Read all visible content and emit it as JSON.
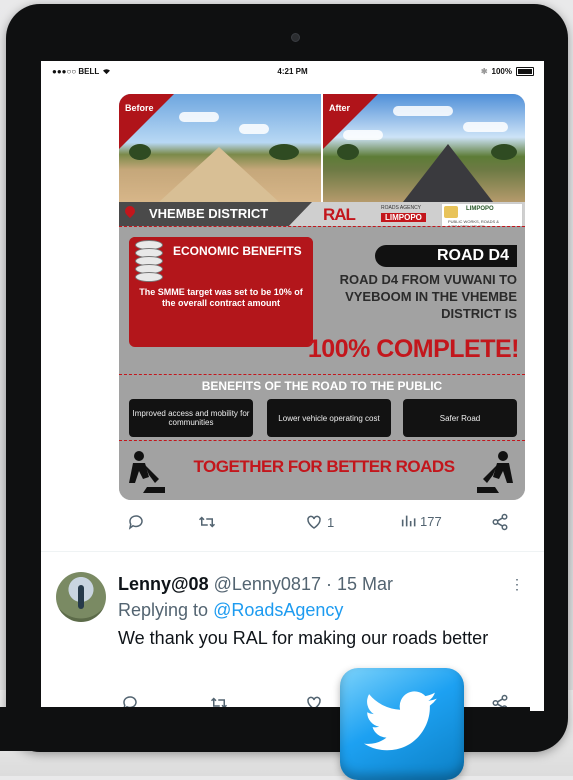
{
  "status_bar": {
    "carrier": "●●●○○ BELL",
    "time": "4:21 PM",
    "battery": "100%"
  },
  "poster": {
    "before_label": "Before",
    "after_label": "After",
    "district": "VHEMBE DISTRICT",
    "logo": {
      "brand": "RAL",
      "agency": "ROADS AGENCY",
      "region": "LIMPOPO"
    },
    "dept_logo": {
      "name": "LIMPOPO",
      "subtitle": "PUBLIC WORKS, ROADS & INFRASTRUCTURE"
    },
    "economic": {
      "title": "ECONOMIC BENEFITS",
      "body": "The SMME target was set to be 10% of the overall contract amount"
    },
    "road_tag": "ROAD D4",
    "road_desc": "ROAD D4 FROM VUWANI TO VYEBOOM IN THE VHEMBE DISTRICT IS",
    "complete": "100% COMPLETE!",
    "benefits_title": "BENEFITS OF THE ROAD TO THE PUBLIC",
    "benefits": [
      "Improved access and mobility for communities",
      "Lower vehicle operating cost",
      "Safer Road"
    ],
    "slogan": "TOGETHER FOR BETTER ROADS"
  },
  "tweet_actions": {
    "reply_count": "",
    "retweet_count": "",
    "like_count": "1",
    "views_count": "177"
  },
  "reply": {
    "name": "Lenny@08",
    "handle": "@Lenny0817",
    "date": "· 15 Mar",
    "replying_prefix": "Replying to",
    "replying_to": "@RoadsAgency",
    "text": "We thank you RAL for making our roads better"
  },
  "colors": {
    "accent_red": "#c3161c",
    "twitter_blue": "#1d9bf0",
    "muted": "#536471"
  }
}
